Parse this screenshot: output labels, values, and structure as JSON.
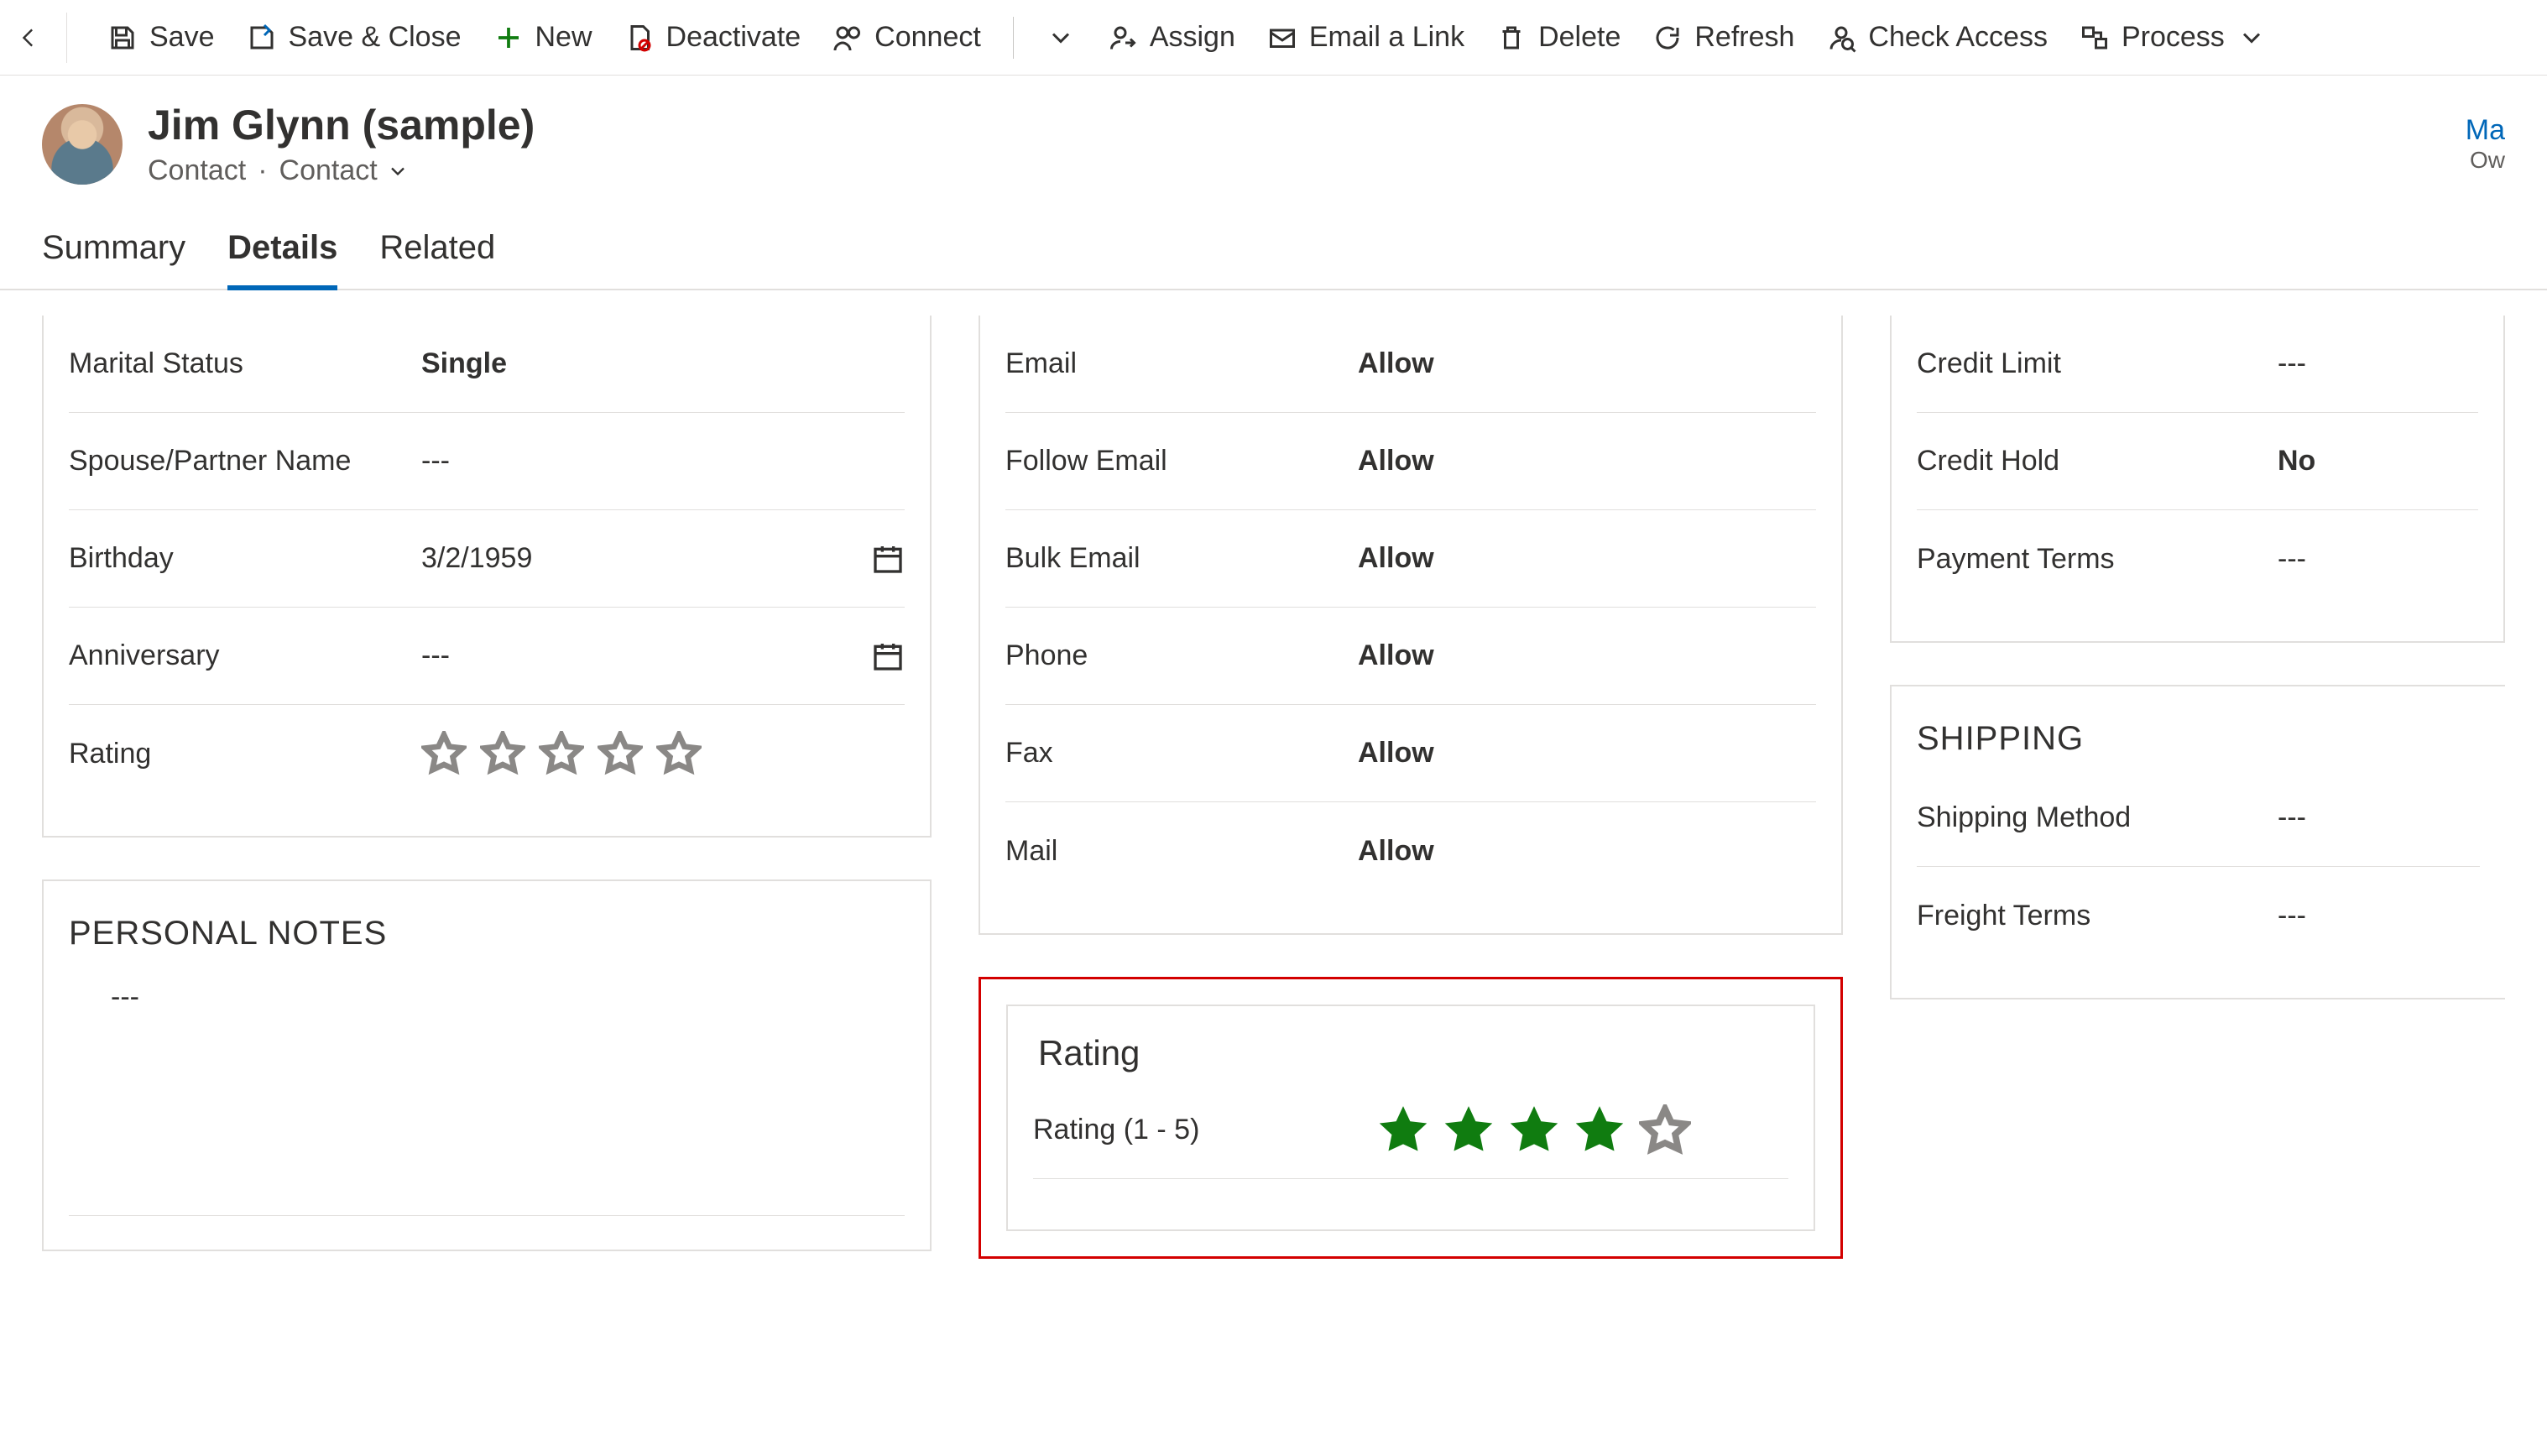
{
  "commands": {
    "save": "Save",
    "save_close": "Save & Close",
    "new": "New",
    "deactivate": "Deactivate",
    "connect": "Connect",
    "assign": "Assign",
    "email_link": "Email a Link",
    "delete": "Delete",
    "refresh": "Refresh",
    "check_access": "Check Access",
    "process": "Process"
  },
  "header": {
    "title": "Jim Glynn (sample)",
    "entity": "Contact",
    "form": "Contact",
    "owner_l1": "Ma",
    "owner_l2": "Ow"
  },
  "tabs": {
    "summary": "Summary",
    "details": "Details",
    "related": "Related"
  },
  "personal": {
    "marital_status_label": "Marital Status",
    "marital_status_value": "Single",
    "spouse_label": "Spouse/Partner Name",
    "spouse_value": "---",
    "birthday_label": "Birthday",
    "birthday_value": "3/2/1959",
    "anniversary_label": "Anniversary",
    "anniversary_value": "---",
    "rating_label": "Rating",
    "rating_value": 0
  },
  "notes": {
    "title": "PERSONAL NOTES",
    "value": "---"
  },
  "contact_methods": {
    "email_label": "Email",
    "email_value": "Allow",
    "follow_label": "Follow Email",
    "follow_value": "Allow",
    "bulk_label": "Bulk Email",
    "bulk_value": "Allow",
    "phone_label": "Phone",
    "phone_value": "Allow",
    "fax_label": "Fax",
    "fax_value": "Allow",
    "mail_label": "Mail",
    "mail_value": "Allow"
  },
  "rating_card": {
    "title": "Rating",
    "label": "Rating (1 - 5)",
    "value": 4,
    "max": 5
  },
  "credit": {
    "credit_limit_label": "Credit Limit",
    "credit_limit_value": "---",
    "credit_hold_label": "Credit Hold",
    "credit_hold_value": "No",
    "payment_terms_label": "Payment Terms",
    "payment_terms_value": "---"
  },
  "shipping": {
    "title": "SHIPPING",
    "method_label": "Shipping Method",
    "method_value": "---",
    "freight_label": "Freight Terms",
    "freight_value": "---"
  }
}
